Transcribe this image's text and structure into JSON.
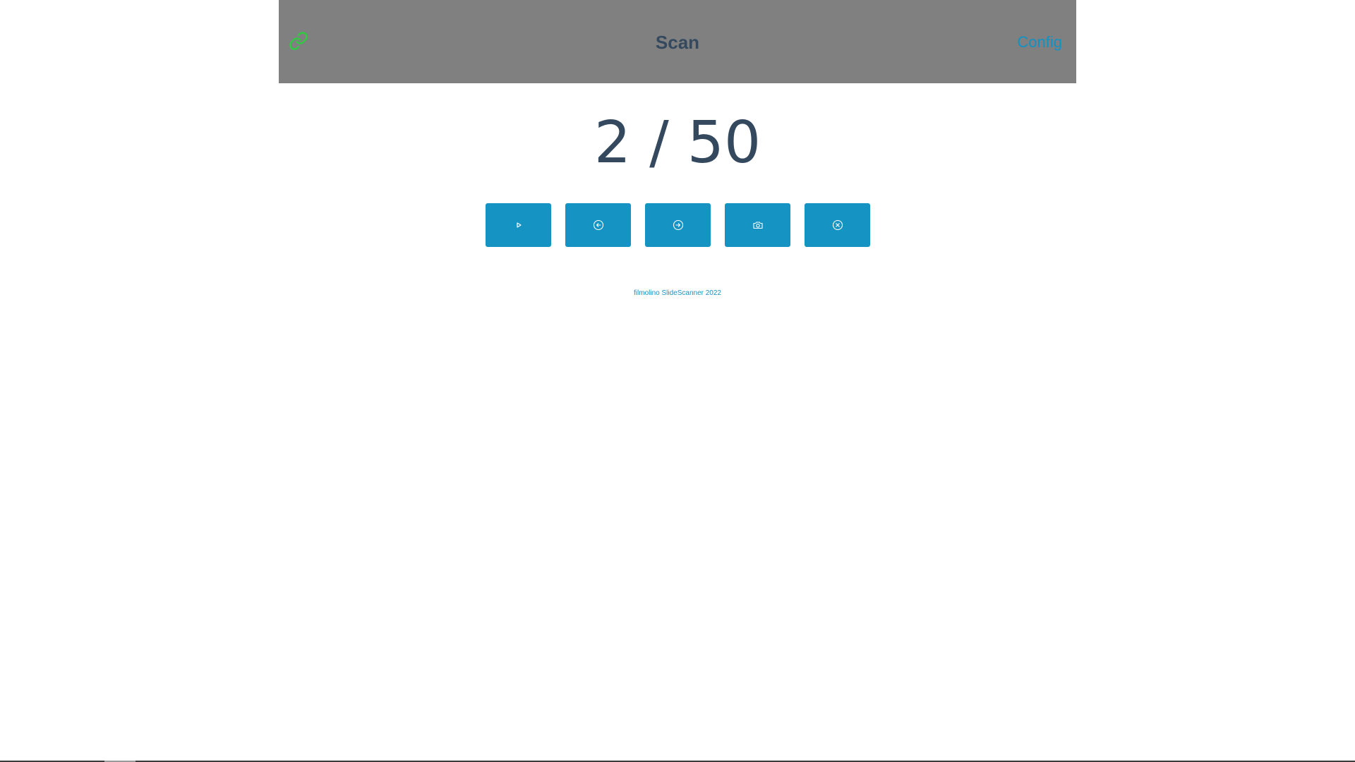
{
  "header": {
    "title": "Scan",
    "config_label": "Config",
    "link_icon": "link-icon",
    "link_icon_color": "#2ecc40"
  },
  "counter": {
    "current": "2",
    "total": "50",
    "text": "2 / 50"
  },
  "controls": [
    {
      "name": "play-button",
      "icon": "play-icon"
    },
    {
      "name": "previous-button",
      "icon": "arrow-left-circle-icon"
    },
    {
      "name": "next-button",
      "icon": "arrow-right-circle-icon"
    },
    {
      "name": "capture-button",
      "icon": "camera-icon"
    },
    {
      "name": "cancel-button",
      "icon": "close-circle-icon"
    }
  ],
  "footer": {
    "text": "filmolino SlideScanner 2022"
  },
  "colors": {
    "header_bg": "#808080",
    "accent": "#1594c4",
    "text": "#34495e"
  }
}
